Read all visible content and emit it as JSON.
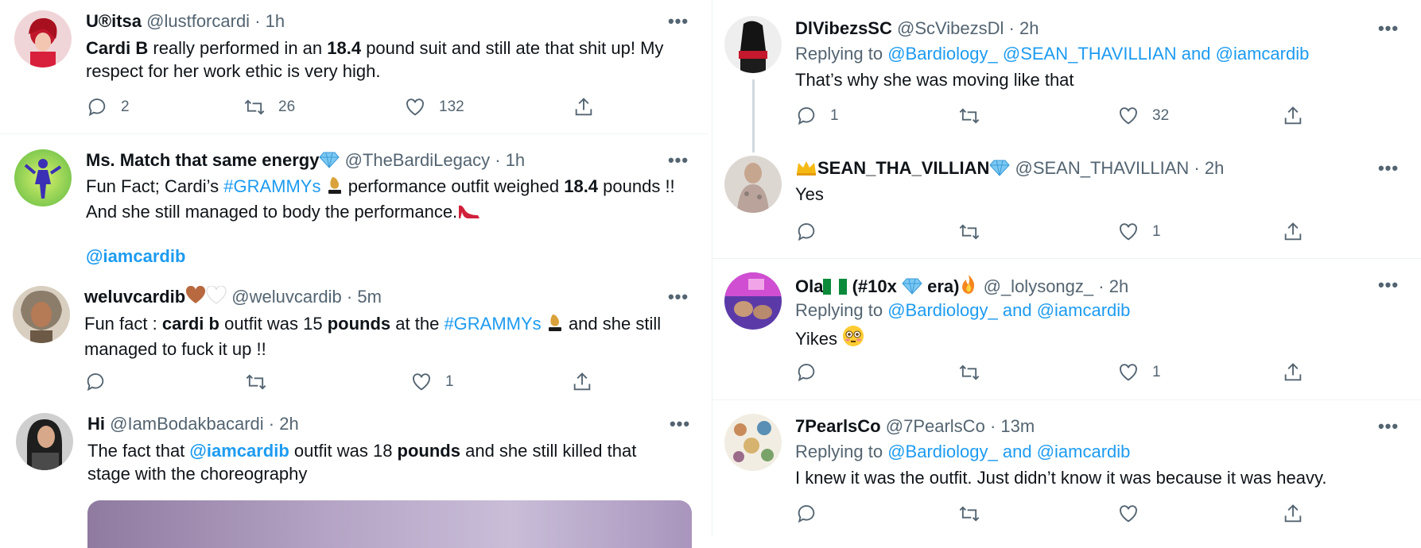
{
  "left_tweets": [
    {
      "name": "U®itsa",
      "handle": "@lustforcardi",
      "time": "1h",
      "text_parts": [
        "Cardi B",
        " really performed in an ",
        "18.4",
        " pound suit and still ate that shit up! My respect for her work ethic is very high."
      ],
      "replies": "2",
      "retweets": "26",
      "likes": "132"
    },
    {
      "name": "Ms. Match that same energy",
      "handle": "@TheBardiLegacy",
      "time": "1h",
      "text_parts": [
        "Fun Fact; Cardi’s ",
        "#GRAMMYs",
        " performance outfit weighed ",
        "18.4",
        " pounds !! And she still managed to body the performance."
      ],
      "mention": "@iamcardib"
    },
    {
      "name": "weluvcardib",
      "handle": "@weluvcardib",
      "time": "5m",
      "text_parts": [
        "Fun fact : ",
        "cardi b",
        " outfit was 15 ",
        "pounds",
        " at the ",
        "#GRAMMYs",
        " and she still managed to fuck it up !!"
      ],
      "replies": "",
      "retweets": "",
      "likes": "1"
    },
    {
      "name": "Hi",
      "handle": "@IamBodakbacardi",
      "time": "2h",
      "text_parts": [
        "The fact that ",
        "@iamcardib",
        " outfit was 18 ",
        "pounds",
        " and she still killed that stage with the choreography"
      ]
    }
  ],
  "right_tweets": [
    {
      "name": "DlVibezsSC",
      "handle": "@ScVibezsDl",
      "time": "2h",
      "replying_to_label": "Replying to",
      "replying_to": [
        "@Bardiology_",
        "@SEAN_THAVILLIAN",
        "and",
        "@iamcardib"
      ],
      "text": "That’s why she was moving like that",
      "replies": "1",
      "retweets": "",
      "likes": "32"
    },
    {
      "name": "SEAN_THA_VILLIAN",
      "handle": "@SEAN_THAVILLIAN",
      "time": "2h",
      "text": "Yes",
      "replies": "",
      "retweets": "",
      "likes": "1"
    },
    {
      "name": "Ola",
      "name_suffix_1": "(#10x",
      "name_suffix_2": "era)",
      "handle": "@_lolysongz_",
      "time": "2h",
      "replying_to_label": "Replying to",
      "replying_to": [
        "@Bardiology_",
        "and",
        "@iamcardib"
      ],
      "text": "Yikes",
      "replies": "",
      "retweets": "",
      "likes": "1"
    },
    {
      "name": "7PearlsCo",
      "handle": "@7PearlsCo",
      "time": "13m",
      "replying_to_label": "Replying to",
      "replying_to": [
        "@Bardiology_",
        "and",
        "@iamcardib"
      ],
      "text": "I knew it was the outfit. Just didn’t know it was because it was heavy.",
      "replies": "",
      "retweets": "",
      "likes": ""
    }
  ],
  "dot": "·",
  "more": "•••",
  "icons": [
    "reply-icon",
    "retweet-icon",
    "like-icon",
    "share-icon",
    "more-icon",
    "diamond-emoji",
    "trophy-emoji",
    "heel-emoji",
    "heart-emoji",
    "crown-emoji",
    "flag-emoji",
    "fire-emoji",
    "flushed-emoji"
  ],
  "colors": {
    "accent": "#1d9bf0",
    "secondary_text": "#536471",
    "primary_text": "#0f1419",
    "divider": "#eff3f4"
  }
}
